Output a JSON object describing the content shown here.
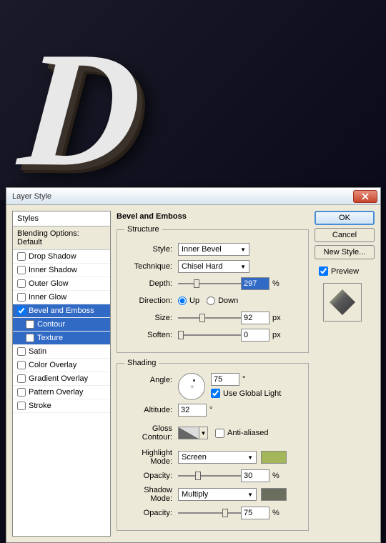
{
  "bg_letter_main": "D",
  "dialog": {
    "title": "Layer Style",
    "styles_header": "Styles",
    "blending_header": "Blending Options: Default",
    "items": [
      {
        "label": "Drop Shadow",
        "checked": false,
        "sub": false,
        "active": false
      },
      {
        "label": "Inner Shadow",
        "checked": false,
        "sub": false,
        "active": false
      },
      {
        "label": "Outer Glow",
        "checked": false,
        "sub": false,
        "active": false
      },
      {
        "label": "Inner Glow",
        "checked": false,
        "sub": false,
        "active": false
      },
      {
        "label": "Bevel and Emboss",
        "checked": true,
        "sub": false,
        "active": true
      },
      {
        "label": "Contour",
        "checked": false,
        "sub": true,
        "active": true
      },
      {
        "label": "Texture",
        "checked": false,
        "sub": true,
        "active": true
      },
      {
        "label": "Satin",
        "checked": false,
        "sub": false,
        "active": false
      },
      {
        "label": "Color Overlay",
        "checked": false,
        "sub": false,
        "active": false
      },
      {
        "label": "Gradient Overlay",
        "checked": false,
        "sub": false,
        "active": false
      },
      {
        "label": "Pattern Overlay",
        "checked": false,
        "sub": false,
        "active": false
      },
      {
        "label": "Stroke",
        "checked": false,
        "sub": false,
        "active": false
      }
    ],
    "panel_title": "Bevel and Emboss",
    "structure": {
      "legend": "Structure",
      "style_label": "Style:",
      "style_value": "Inner Bevel",
      "technique_label": "Technique:",
      "technique_value": "Chisel Hard",
      "depth_label": "Depth:",
      "depth_value": "297",
      "depth_unit": "%",
      "direction_label": "Direction:",
      "up": "Up",
      "down": "Down",
      "size_label": "Size:",
      "size_value": "92",
      "size_unit": "px",
      "soften_label": "Soften:",
      "soften_value": "0",
      "soften_unit": "px"
    },
    "shading": {
      "legend": "Shading",
      "angle_label": "Angle:",
      "angle_value": "75",
      "angle_unit": "°",
      "global_light": "Use Global Light",
      "altitude_label": "Altitude:",
      "altitude_value": "32",
      "altitude_unit": "°",
      "gloss_label": "Gloss Contour:",
      "antialiased": "Anti-aliased",
      "highlight_label": "Highlight Mode:",
      "highlight_value": "Screen",
      "highlight_color": "#a3b65a",
      "highlight_opacity_label": "Opacity:",
      "highlight_opacity_value": "30",
      "opacity_unit": "%",
      "shadow_label": "Shadow Mode:",
      "shadow_value": "Multiply",
      "shadow_color": "#6a6e5f",
      "shadow_opacity_label": "Opacity:",
      "shadow_opacity_value": "75"
    },
    "buttons": {
      "ok": "OK",
      "cancel": "Cancel",
      "new_style": "New Style...",
      "preview": "Preview"
    }
  }
}
